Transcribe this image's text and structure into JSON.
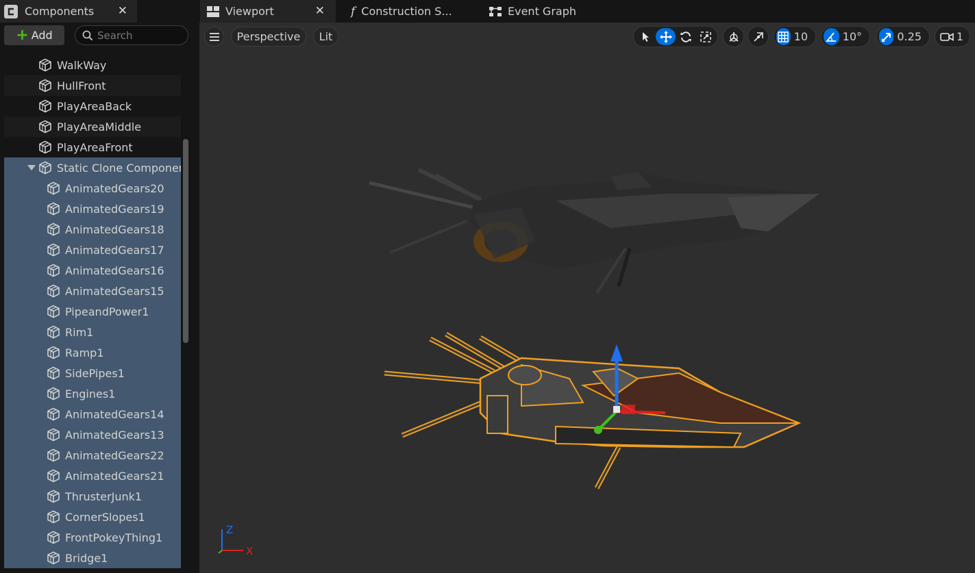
{
  "components_panel": {
    "tab_title": "Components",
    "add_label": "Add",
    "search_placeholder": "Search",
    "items": [
      {
        "label": "WalkWay",
        "level": 0
      },
      {
        "label": "HullFront",
        "level": 0
      },
      {
        "label": "PlayAreaBack",
        "level": 0
      },
      {
        "label": "PlayAreaMiddle",
        "level": 0
      },
      {
        "label": "PlayAreaFront",
        "level": 0
      },
      {
        "label": "Static Clone Componen",
        "level": 0,
        "expanded": true
      },
      {
        "label": "AnimatedGears20",
        "level": 1
      },
      {
        "label": "AnimatedGears19",
        "level": 1
      },
      {
        "label": "AnimatedGears18",
        "level": 1
      },
      {
        "label": "AnimatedGears17",
        "level": 1
      },
      {
        "label": "AnimatedGears16",
        "level": 1
      },
      {
        "label": "AnimatedGears15",
        "level": 1
      },
      {
        "label": "PipeandPower1",
        "level": 1
      },
      {
        "label": "Rim1",
        "level": 1
      },
      {
        "label": "Ramp1",
        "level": 1
      },
      {
        "label": "SidePipes1",
        "level": 1
      },
      {
        "label": "Engines1",
        "level": 1
      },
      {
        "label": "AnimatedGears14",
        "level": 1
      },
      {
        "label": "AnimatedGears13",
        "level": 1
      },
      {
        "label": "AnimatedGears22",
        "level": 1
      },
      {
        "label": "AnimatedGears21",
        "level": 1
      },
      {
        "label": "ThrusterJunk1",
        "level": 1
      },
      {
        "label": "CornerSlopes1",
        "level": 1
      },
      {
        "label": "FrontPokeyThing1",
        "level": 1
      },
      {
        "label": "Bridge1",
        "level": 1
      }
    ]
  },
  "tabs": {
    "viewport": "Viewport",
    "construction": "Construction S...",
    "event_graph": "Event Graph"
  },
  "viewport": {
    "view_mode": "Perspective",
    "lighting": "Lit",
    "grid_snap": "10",
    "rotation_snap": "10°",
    "scale_snap": "0.25",
    "camera_speed": "1",
    "axis_z": "Z",
    "axis_x": "X"
  },
  "colors": {
    "selection_row": "#44596f",
    "accent_blue": "#0070e0",
    "selection_outline": "#f0a020",
    "gizmo_x": "#e02020",
    "gizmo_y": "#40c020",
    "gizmo_z": "#2070f0"
  }
}
